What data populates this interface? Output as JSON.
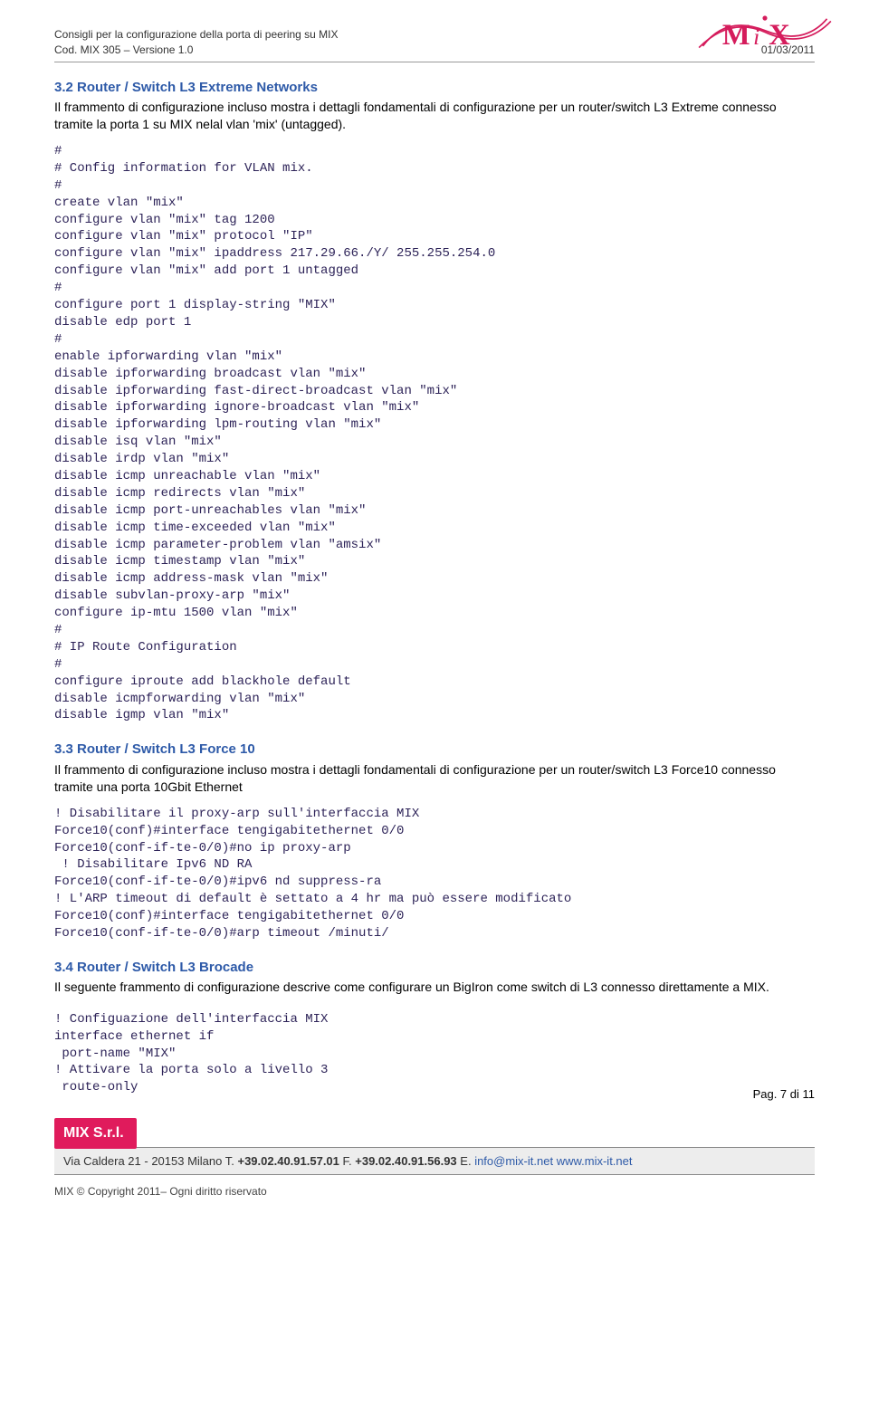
{
  "header": {
    "line1": "Consigli per la configurazione della porta di peering su MIX",
    "line2": "Cod. MIX 305 – Versione 1.0",
    "date": "01/03/2011"
  },
  "sections": {
    "s32": {
      "heading": "3.2  Router / Switch L3 Extreme Networks",
      "intro": "Il frammento di configurazione incluso mostra i dettagli fondamentali di configurazione per un router/switch L3 Extreme connesso tramite la porta 1 su MIX nelal vlan 'mix' (untagged).",
      "code": "#\n# Config information for VLAN mix.\n#\ncreate vlan \"mix\"\nconfigure vlan \"mix\" tag 1200\nconfigure vlan \"mix\" protocol \"IP\"\nconfigure vlan \"mix\" ipaddress 217.29.66./Y/ 255.255.254.0\nconfigure vlan \"mix\" add port 1 untagged\n#\nconfigure port 1 display-string \"MIX\"\ndisable edp port 1\n#\nenable ipforwarding vlan \"mix\"\ndisable ipforwarding broadcast vlan \"mix\"\ndisable ipforwarding fast-direct-broadcast vlan \"mix\"\ndisable ipforwarding ignore-broadcast vlan \"mix\"\ndisable ipforwarding lpm-routing vlan \"mix\"\ndisable isq vlan \"mix\"\ndisable irdp vlan \"mix\"\ndisable icmp unreachable vlan \"mix\"\ndisable icmp redirects vlan \"mix\"\ndisable icmp port-unreachables vlan \"mix\"\ndisable icmp time-exceeded vlan \"mix\"\ndisable icmp parameter-problem vlan \"amsix\"\ndisable icmp timestamp vlan \"mix\"\ndisable icmp address-mask vlan \"mix\"\ndisable subvlan-proxy-arp \"mix\"\nconfigure ip-mtu 1500 vlan \"mix\"\n#\n# IP Route Configuration\n#\nconfigure iproute add blackhole default\ndisable icmpforwarding vlan \"mix\"\ndisable igmp vlan \"mix\""
    },
    "s33": {
      "heading": "3.3  Router / Switch L3 Force 10",
      "intro": "Il frammento di configurazione incluso mostra i dettagli fondamentali di configurazione per un router/switch L3 Force10 connesso tramite una porta 10Gbit Ethernet",
      "code": "! Disabilitare il proxy-arp sull'interfaccia MIX\nForce10(conf)#interface tengigabitethernet 0/0\nForce10(conf-if-te-0/0)#no ip proxy-arp\n ! Disabilitare Ipv6 ND RA\nForce10(conf-if-te-0/0)#ipv6 nd suppress-ra\n! L'ARP timeout di default è settato a 4 hr ma può essere modificato\nForce10(conf)#interface tengigabitethernet 0/0\nForce10(conf-if-te-0/0)#arp timeout /minuti/"
    },
    "s34": {
      "heading": "3.4  Router / Switch L3 Brocade",
      "intro": "Il seguente frammento di configurazione descrive come configurare un BigIron come switch di L3 connesso direttamente a MIX.",
      "code": "! Configuazione dell'interfaccia MIX\ninterface ethernet if\n port-name \"MIX\"\n! Attivare la porta solo a livello 3\n route-only"
    }
  },
  "page_number": "Pag. 7 di 11",
  "footer": {
    "brand": "MIX S.r.l.",
    "address_prefix": "Via Caldera 21 - 20153 Milano T. ",
    "phone1": "+39.02.40.91.57.01",
    "fax_label": " F. ",
    "phone2": "+39.02.40.91.56.93",
    "email_label": " E. ",
    "email": "info@mix-it.net",
    "site_sep": "  ",
    "site": "www.mix-it.net"
  },
  "copyright": "MIX © Copyright 2011– Ogni diritto riservato",
  "logo_text": "MIX"
}
